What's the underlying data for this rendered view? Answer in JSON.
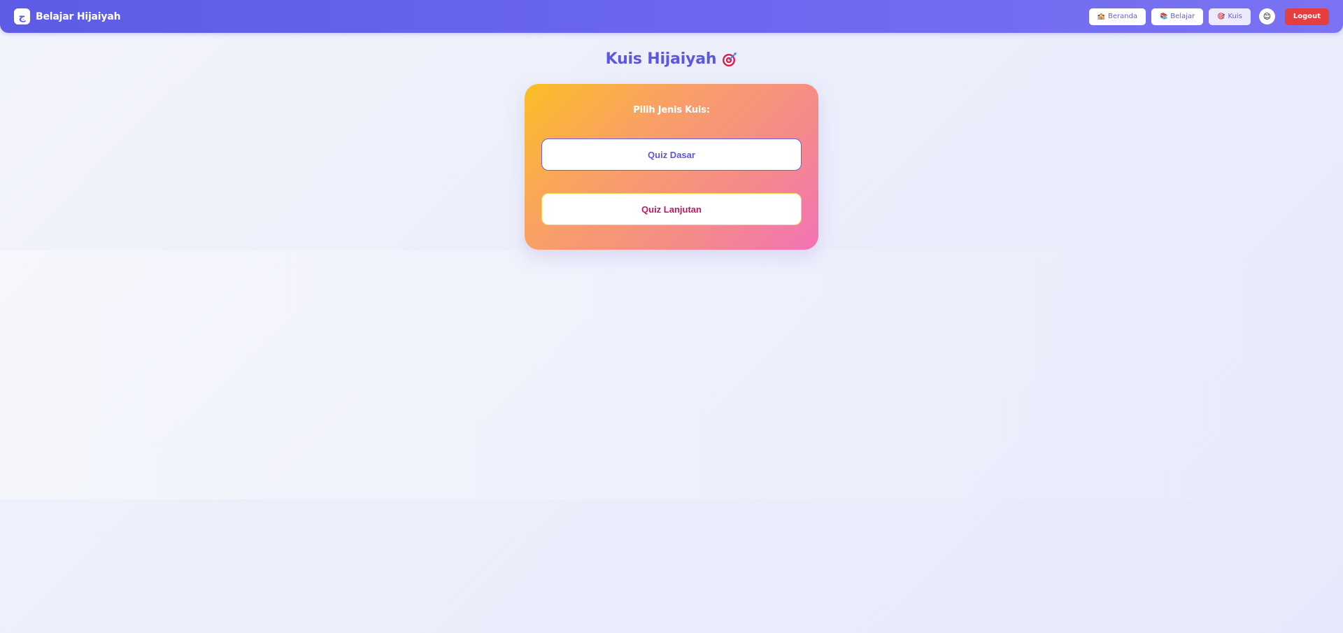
{
  "app": {
    "logo_glyph": "ج",
    "title": "Belajar Hijaiyah"
  },
  "nav": {
    "items": [
      {
        "icon": "🏫",
        "label": "Beranda",
        "active": false
      },
      {
        "icon": "📚",
        "label": "Belajar",
        "active": false
      },
      {
        "icon": "🎯",
        "label": "Kuis",
        "active": true
      }
    ],
    "avatar_emoji": "😊",
    "logout_label": "Logout"
  },
  "page": {
    "title": "Kuis Hijaiyah",
    "title_icon": "target-icon"
  },
  "card": {
    "label": "Pilih Jenis Kuis:",
    "buttons": {
      "basic": "Quiz Dasar",
      "advanced": "Quiz Lanjutan"
    }
  },
  "colors": {
    "nav_gradient_start": "#5c5ce6",
    "nav_gradient_end": "#7a72f2",
    "accent": "#5b57e0",
    "logout": "#e53e3e",
    "card_gradient": [
      "#fbbf24",
      "#f9a066",
      "#f58a8a",
      "#f472b6"
    ],
    "advanced_text": "#be185d"
  }
}
